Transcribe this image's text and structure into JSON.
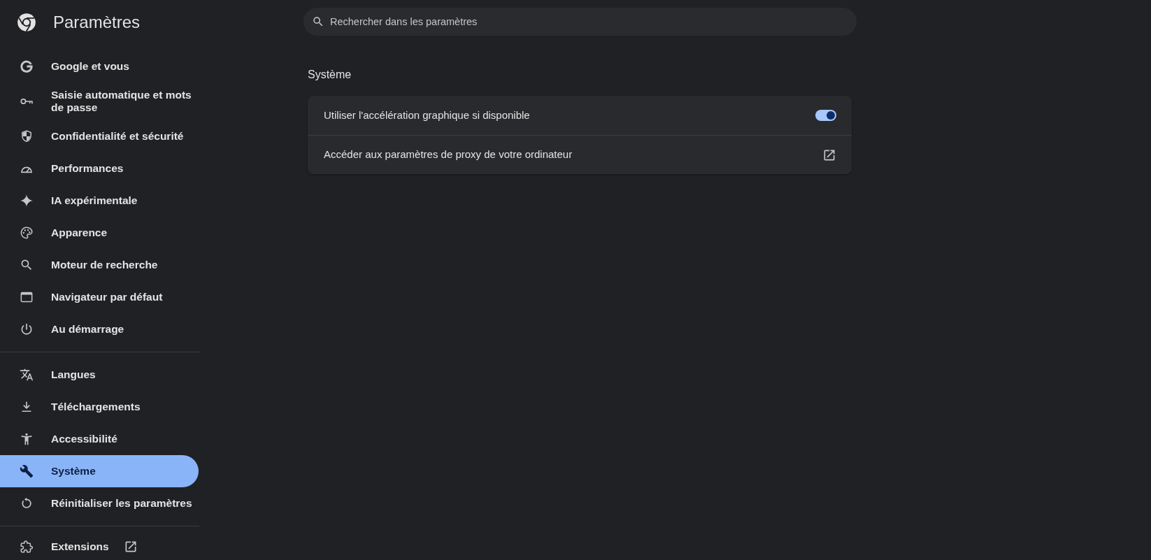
{
  "sidebar": {
    "title": "Paramètres",
    "groups": [
      {
        "items": [
          {
            "label": "Google et vous",
            "kind": "page",
            "selected": false
          },
          {
            "label": "Saisie automatique et mots de passe",
            "kind": "page",
            "selected": false
          },
          {
            "label": "Confidentialité et sécurité",
            "kind": "page",
            "selected": false
          },
          {
            "label": "Performances",
            "kind": "page",
            "selected": false
          },
          {
            "label": "IA expérimentale",
            "kind": "page",
            "selected": false
          },
          {
            "label": "Apparence",
            "kind": "page",
            "selected": false
          },
          {
            "label": "Moteur de recherche",
            "kind": "page",
            "selected": false
          },
          {
            "label": "Navigateur par défaut",
            "kind": "page",
            "selected": false
          },
          {
            "label": "Au démarrage",
            "kind": "page",
            "selected": false
          }
        ]
      },
      {
        "items": [
          {
            "label": "Langues",
            "kind": "page",
            "selected": false
          },
          {
            "label": "Téléchargements",
            "kind": "page",
            "selected": false
          },
          {
            "label": "Accessibilité",
            "kind": "page",
            "selected": false
          },
          {
            "label": "Système",
            "kind": "page",
            "selected": true
          },
          {
            "label": "Réinitialiser les paramètres",
            "kind": "page",
            "selected": false
          }
        ]
      },
      {
        "items": [
          {
            "label": "Extensions",
            "kind": "external",
            "selected": false
          }
        ]
      }
    ]
  },
  "search": {
    "placeholder": "Rechercher dans les paramètres"
  },
  "section": {
    "title": "Système",
    "rows": [
      {
        "kind": "toggle",
        "label": "Utiliser l'accélération graphique si disponible",
        "on": true
      },
      {
        "kind": "external_link",
        "label": "Accéder aux paramètres de proxy de votre ordinateur"
      }
    ]
  }
}
